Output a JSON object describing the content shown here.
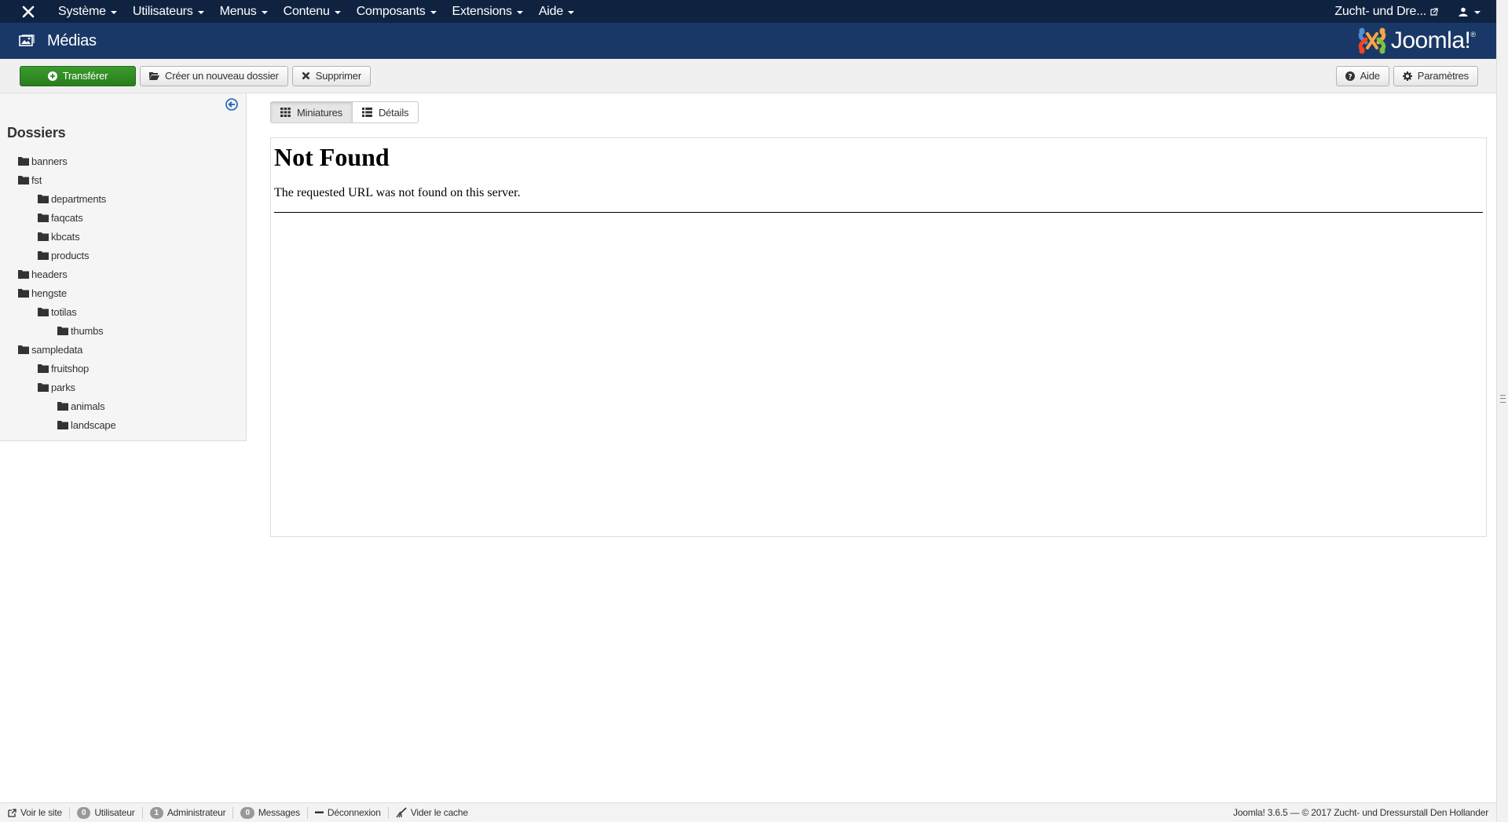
{
  "topnav": {
    "menu": [
      {
        "label": "Système"
      },
      {
        "label": "Utilisateurs"
      },
      {
        "label": "Menus"
      },
      {
        "label": "Contenu"
      },
      {
        "label": "Composants"
      },
      {
        "label": "Extensions"
      },
      {
        "label": "Aide"
      }
    ],
    "site_name": "Zucht- und Dre..."
  },
  "header": {
    "title": "Médias",
    "brand": "Joomla!"
  },
  "toolbar": {
    "upload": "Transférer",
    "new_folder": "Créer un nouveau dossier",
    "delete": "Supprimer",
    "help": "Aide",
    "options": "Paramètres"
  },
  "sidebar": {
    "heading": "Dossiers",
    "folders": [
      {
        "label": "banners",
        "level": 0
      },
      {
        "label": "fst",
        "level": 0
      },
      {
        "label": "departments",
        "level": 1
      },
      {
        "label": "faqcats",
        "level": 1
      },
      {
        "label": "kbcats",
        "level": 1
      },
      {
        "label": "products",
        "level": 1
      },
      {
        "label": "headers",
        "level": 0
      },
      {
        "label": "hengste",
        "level": 0
      },
      {
        "label": "totilas",
        "level": 1
      },
      {
        "label": "thumbs",
        "level": 2
      },
      {
        "label": "sampledata",
        "level": 0
      },
      {
        "label": "fruitshop",
        "level": 1
      },
      {
        "label": "parks",
        "level": 1
      },
      {
        "label": "animals",
        "level": 2
      },
      {
        "label": "landscape",
        "level": 2
      }
    ]
  },
  "views": {
    "thumbnails": "Miniatures",
    "details": "Détails"
  },
  "frame": {
    "title": "Not Found",
    "message": "The requested URL was not found on this server."
  },
  "statusbar": {
    "view_site": "Voir le site",
    "users_count": "0",
    "users_label": "Utilisateur",
    "admins_count": "1",
    "admins_label": "Administrateur",
    "messages_count": "0",
    "messages_label": "Messages",
    "logout": "Déconnexion",
    "clear_cache": "Vider le cache",
    "copyright": "Joomla! 3.6.5  —  © 2017 Zucht- und Dressurstall Den Hollander"
  },
  "colors": {
    "navbar": "#0f2340",
    "header": "#1a3867",
    "success": "#2f8a24"
  }
}
